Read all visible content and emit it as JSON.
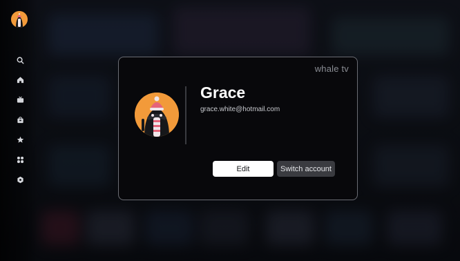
{
  "profile": {
    "name": "Grace",
    "email": "grace.white@hotmail.com"
  },
  "brand": {
    "logo_text": "whale tv"
  },
  "actions": {
    "edit_label": "Edit",
    "switch_label": "Switch account"
  },
  "sidebar": {
    "items": [
      {
        "icon": "search-icon"
      },
      {
        "icon": "home-icon"
      },
      {
        "icon": "tv-icon"
      },
      {
        "icon": "store-icon"
      },
      {
        "icon": "star-icon"
      },
      {
        "icon": "apps-icon"
      },
      {
        "icon": "settings-icon"
      }
    ]
  },
  "colors": {
    "accent_avatar": "#f29a3a",
    "card_background": "#08080b",
    "primary_button": "#ffffff",
    "secondary_button": "#3a3b40"
  }
}
